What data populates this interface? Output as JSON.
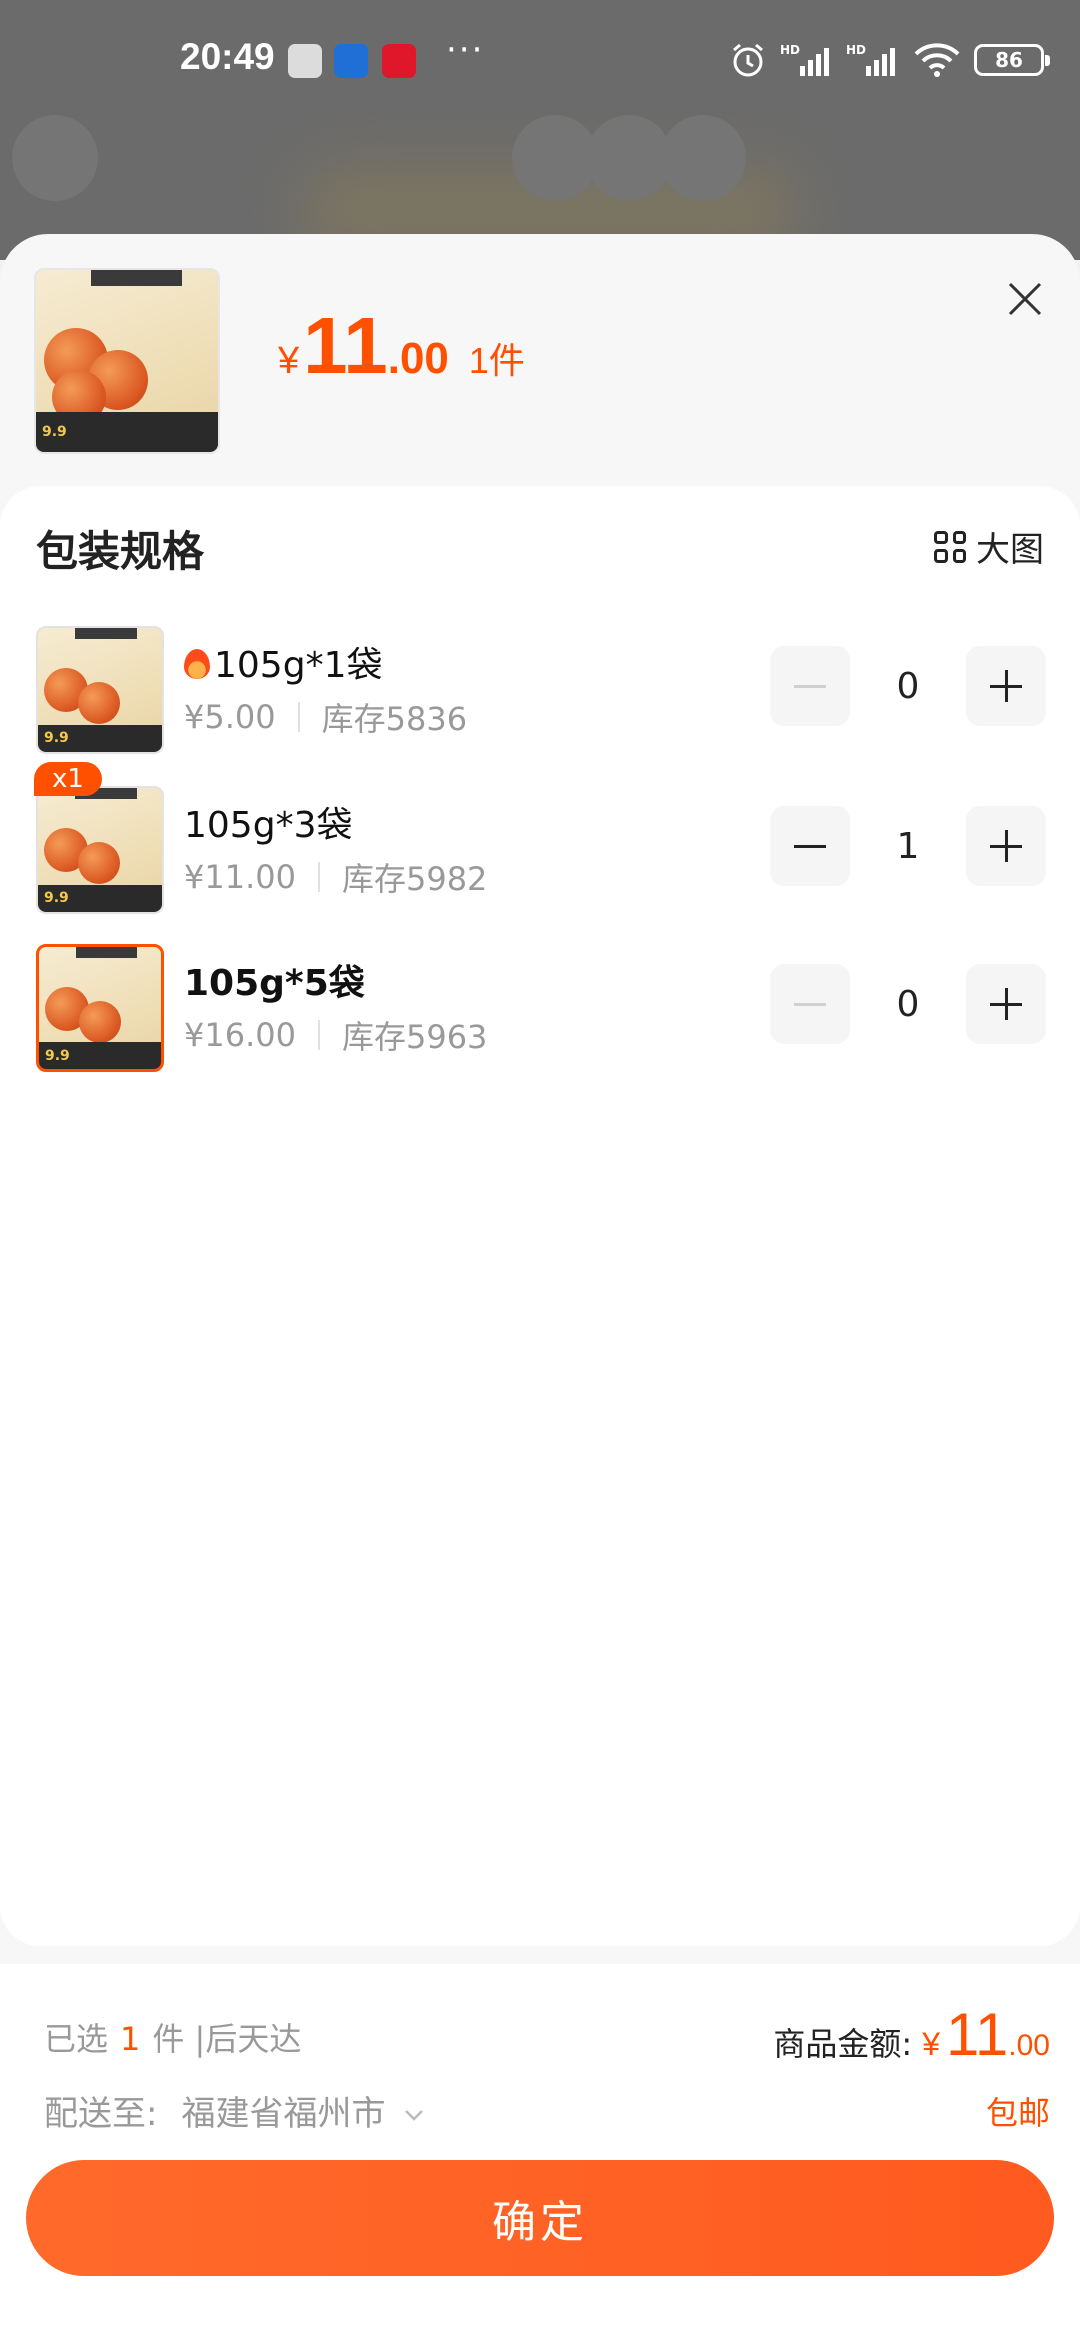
{
  "status_bar": {
    "time": "20:49",
    "dots": "···",
    "network": "HD",
    "battery": "86"
  },
  "header": {
    "currency": "¥",
    "price_int": "11",
    "price_dec": ".00",
    "quantity": "1件",
    "close_icon": "close-icon"
  },
  "section": {
    "title": "包装规格",
    "bigview_label": "大图"
  },
  "skus": [
    {
      "name": "105g*1袋",
      "price": "¥5.00",
      "stock": "库存5836",
      "qty": "0",
      "hot": true,
      "badge": ""
    },
    {
      "name": "105g*3袋",
      "price": "¥11.00",
      "stock": "库存5982",
      "qty": "1",
      "hot": false,
      "badge": "x1"
    },
    {
      "name": "105g*5袋",
      "price": "¥16.00",
      "stock": "库存5963",
      "qty": "0",
      "hot": false,
      "badge": ""
    }
  ],
  "footer": {
    "selected_prefix": "已选",
    "selected_count": "1",
    "selected_suffix": "件 |后天达",
    "amount_label": "商品金额:",
    "amount_currency": "¥",
    "amount_int": "11",
    "amount_dec": ".00",
    "ship_label": "配送至:",
    "ship_dest": "福建省福州市",
    "free_shipping": "包邮",
    "confirm": "确定"
  },
  "colors": {
    "accent": "#ff5000"
  }
}
